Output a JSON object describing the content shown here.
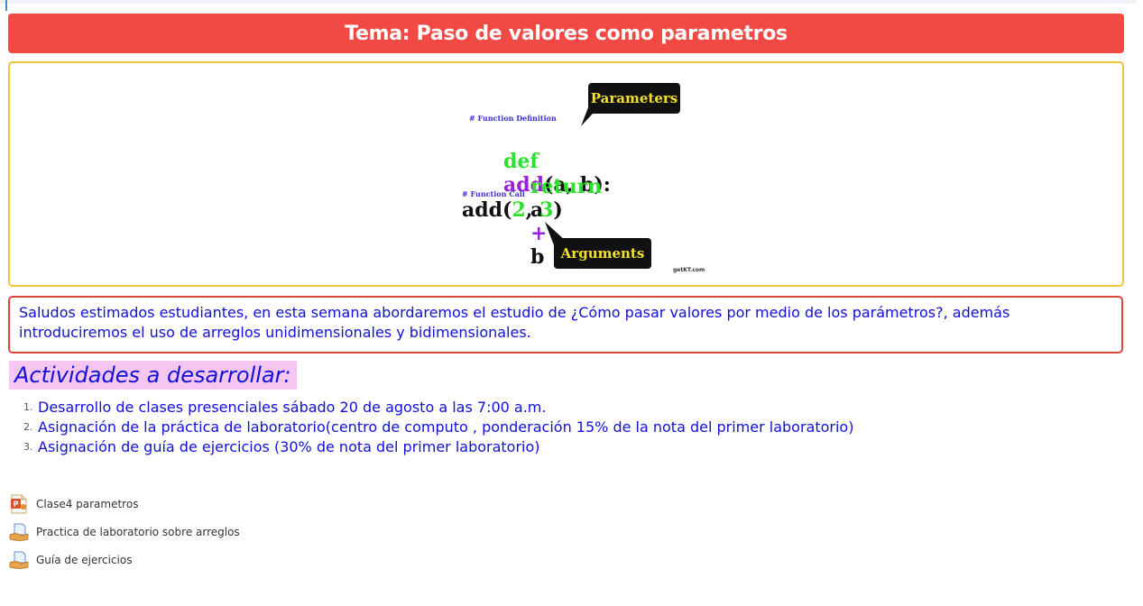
{
  "header": {
    "title": "Tema: Paso de valores como parametros"
  },
  "figure": {
    "comment_definition": "# Function Definition",
    "comment_call": "# Function Call",
    "kw_def": "def",
    "fn_name": "add",
    "def_args": "(a, b):",
    "kw_return": "return",
    "return_a": "a",
    "op_plus": "+",
    "return_b": "b",
    "call_name": "add(",
    "call_arg1": "2",
    "call_sep": ", ",
    "call_arg2": "3",
    "call_close": ")",
    "parameters_label": "Parameters",
    "arguments_label": "Arguments",
    "credit": "getKT.com"
  },
  "intro": {
    "text": "Saludos estimados estudiantes, en esta semana abordaremos el estudio de ¿Cómo pasar valores por medio de los parámetros?, además introduciremos el uso de arreglos unidimensionales y bidimensionales."
  },
  "activities": {
    "heading": "Actividades a desarrollar:",
    "items": [
      {
        "num": "1.",
        "text": "Desarrollo de clases presenciales sábado 20 de agosto  a las 7:00 a.m."
      },
      {
        "num": "2.",
        "text": "Asignación de la práctica de laboratorio(centro de computo , ponderación 15% de la nota del primer laboratorio)"
      },
      {
        "num": "3.",
        "text": "Asignación de guía de ejercicios (30% de nota del primer laboratorio)"
      }
    ]
  },
  "resources": [
    {
      "icon": "powerpoint-file-icon",
      "label": "Clase4 parametros"
    },
    {
      "icon": "assignment-icon",
      "label": "Practica de laboratorio sobre arreglos"
    },
    {
      "icon": "assignment-icon",
      "label": "Guía de ejercicios"
    }
  ],
  "colors": {
    "title_bg": "#f14a44",
    "image_border": "#f5c23a",
    "intro_border": "#e0453c",
    "text_blue": "#1010d8",
    "heading_bg": "#f6c6f3"
  }
}
